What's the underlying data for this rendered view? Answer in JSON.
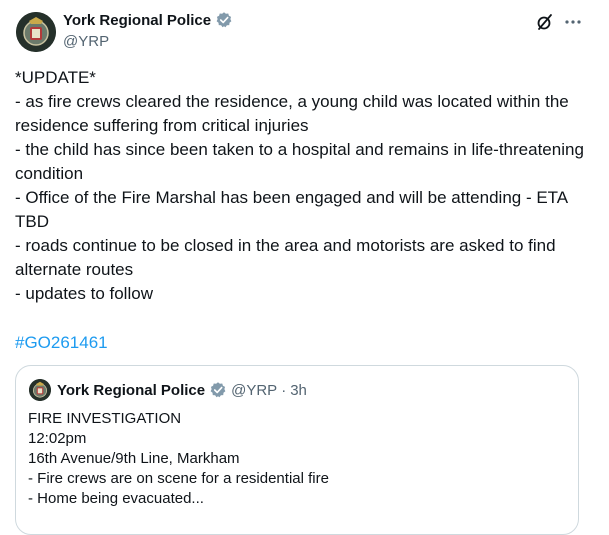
{
  "author": {
    "name": "York Regional Police",
    "handle": "@YRP"
  },
  "tweet": {
    "lines": [
      "*UPDATE*",
      "- as fire crews cleared the residence, a young child was located within the residence suffering from critical injuries",
      "- the child has since been taken to a hospital and remains in life-threatening condition",
      "- Office of the Fire Marshal has been engaged and will be attending - ETA TBD",
      "- roads continue to be closed in the area and motorists are asked to find alternate routes",
      "- updates to follow"
    ],
    "hashtag": "#GO261461"
  },
  "quote": {
    "name": "York Regional Police",
    "handle": "@YRP",
    "separator": "·",
    "time": "3h",
    "lines": [
      "FIRE INVESTIGATION",
      "12:02pm",
      "16th Avenue/9th Line, Markham",
      "- Fire crews are on scene for a residential fire",
      "- Home being evacuated..."
    ]
  },
  "icons": {
    "verified": "verified-badge-icon",
    "grok": "grok-icon",
    "more": "more-icon"
  },
  "colors": {
    "text": "#0f1419",
    "secondary": "#536471",
    "link": "#1d9bf0",
    "border": "#cfd9de"
  }
}
